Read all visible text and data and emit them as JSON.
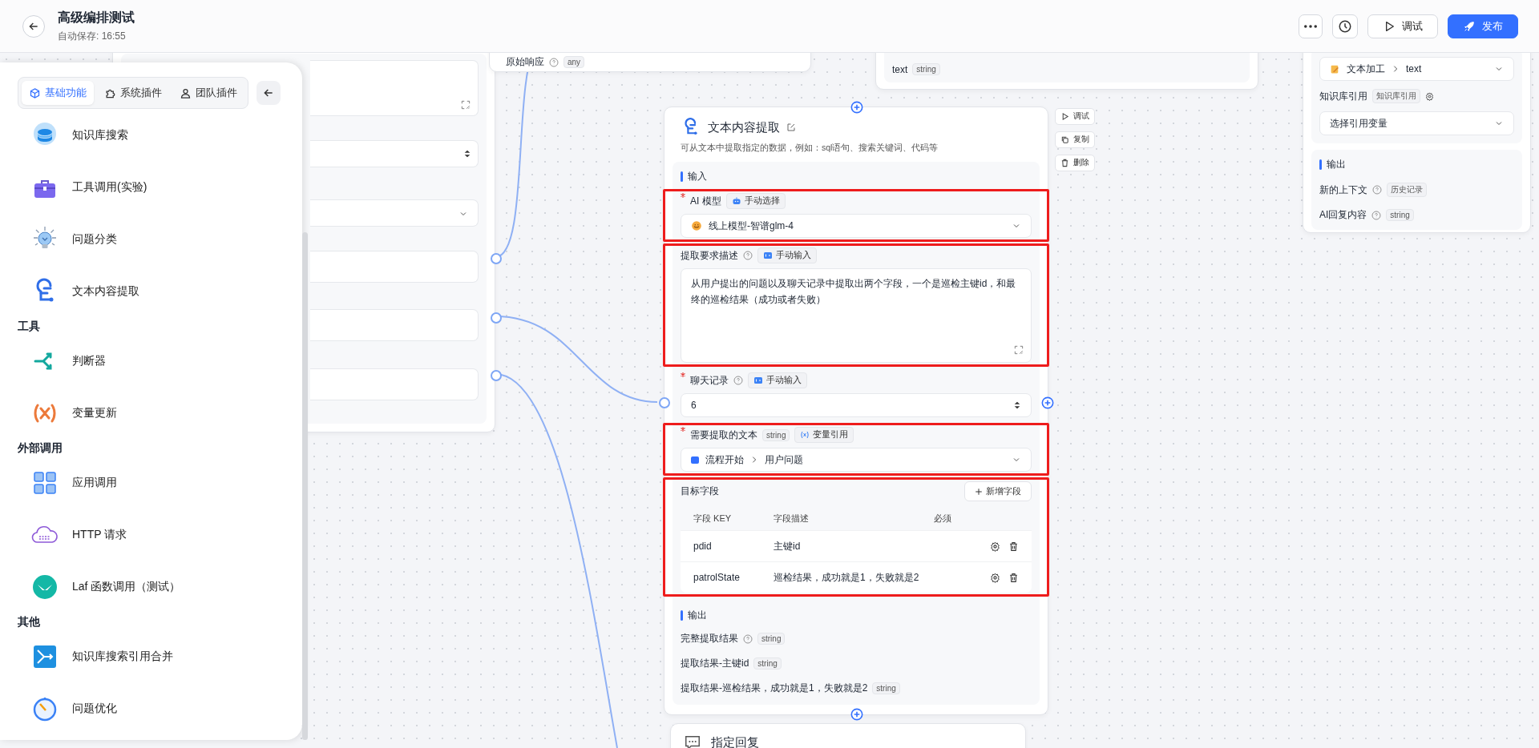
{
  "header": {
    "title": "高级编排测试",
    "autosave": "自动保存: 16:55",
    "actions": [
      {
        "kind": "more"
      },
      {
        "kind": "history"
      },
      {
        "kind": "debug",
        "label": "调试"
      },
      {
        "kind": "publish",
        "label": "发布"
      }
    ]
  },
  "panel": {
    "tabs": [
      {
        "kind": "cube",
        "label": "基础功能",
        "selected": true
      },
      {
        "kind": "puzzle",
        "label": "系统插件",
        "selected": false
      },
      {
        "kind": "person",
        "label": "团队插件",
        "selected": false
      }
    ],
    "groups": [
      {
        "items": [
          {
            "kind": "dataset",
            "label": "知识库搜索"
          },
          {
            "kind": "toolbox",
            "label": "工具调用(实验)"
          },
          {
            "kind": "bulb",
            "label": "问题分类"
          },
          {
            "kind": "extract",
            "label": "文本内容提取"
          }
        ]
      },
      {
        "title": "工具",
        "items": [
          {
            "kind": "branch",
            "label": "判断器"
          },
          {
            "kind": "variable",
            "label": "变量更新"
          }
        ]
      },
      {
        "title": "外部调用",
        "items": [
          {
            "kind": "apps",
            "label": "应用调用"
          },
          {
            "kind": "http",
            "label": "HTTP 请求"
          },
          {
            "kind": "laf",
            "label": "Laf 函数调用（测试）"
          }
        ]
      },
      {
        "title": "其他",
        "items": [
          {
            "kind": "merge",
            "label": "知识库搜索引用合并"
          },
          {
            "kind": "optimize",
            "label": "问题优化"
          }
        ]
      }
    ]
  },
  "canvas": {
    "response_card": {
      "label": "原始响应",
      "help": true,
      "type": "any"
    },
    "text_card": {
      "label": "text",
      "type": "string"
    },
    "context_card": {
      "source": "文本加工",
      "field": "text",
      "dataset_label": "知识库引用",
      "dataset_tag": "知识库引用",
      "dataset_placeholder": "选择引用变量",
      "output_title": "输出",
      "outputs": [
        {
          "label": "新的上下文",
          "help": true,
          "type": "历史记录"
        },
        {
          "label": "AI回复内容",
          "help": true,
          "type": "string"
        }
      ]
    },
    "extract_node": {
      "title": "文本内容提取",
      "description": "可从文本中提取指定的数据，例如：sql语句、搜索关键词、代码等",
      "actions": [
        {
          "kind": "run",
          "label": "调试"
        },
        {
          "kind": "copy",
          "label": "复制"
        },
        {
          "kind": "delete",
          "label": "删除"
        }
      ],
      "input_title": "输入",
      "inputs": [
        {
          "kind": "select",
          "label": "AI 模型",
          "required": true,
          "help": false,
          "highlighted": true,
          "tag": {
            "kind": "select",
            "text": "手动选择"
          },
          "value": "线上模型-智谱glm-4"
        },
        {
          "kind": "textarea",
          "label": "提取要求描述",
          "required": false,
          "help": true,
          "highlighted": true,
          "tag": {
            "kind": "input",
            "text": "手动输入"
          },
          "value": "从用户提出的问题以及聊天记录中提取出两个字段，一个是巡检主键id，和最终的巡检结果（成功或者失败）"
        },
        {
          "kind": "number",
          "label": "聊天记录",
          "required": true,
          "help": true,
          "highlighted": false,
          "tag": {
            "kind": "input",
            "text": "手动输入"
          },
          "value": "6"
        },
        {
          "kind": "reference",
          "label": "需要提取的文本",
          "required": true,
          "help": false,
          "type": "string",
          "highlighted": true,
          "tag": {
            "kind": "reference",
            "text": "变量引用"
          },
          "source": "流程开始",
          "field": "用户问题"
        },
        {
          "kind": "fields",
          "label": "目标字段",
          "highlighted": true,
          "add_label": "新增字段",
          "columns": [
            "字段 KEY",
            "字段描述",
            "必须"
          ],
          "rows": [
            {
              "key": "pdid",
              "description": "主键id"
            },
            {
              "key": "patrolState",
              "description": "巡检结果，成功就是1，失败就是2"
            }
          ]
        }
      ],
      "output_title": "输出",
      "outputs": [
        {
          "label": "完整提取结果",
          "help": true,
          "type": "string"
        },
        {
          "label": "提取结果-主键id",
          "help": false,
          "type": "string"
        },
        {
          "label": "提取结果-巡检结果，成功就是1，失败就是2",
          "help": false,
          "type": "string"
        }
      ]
    },
    "reply_node": {
      "title": "指定回复"
    }
  }
}
